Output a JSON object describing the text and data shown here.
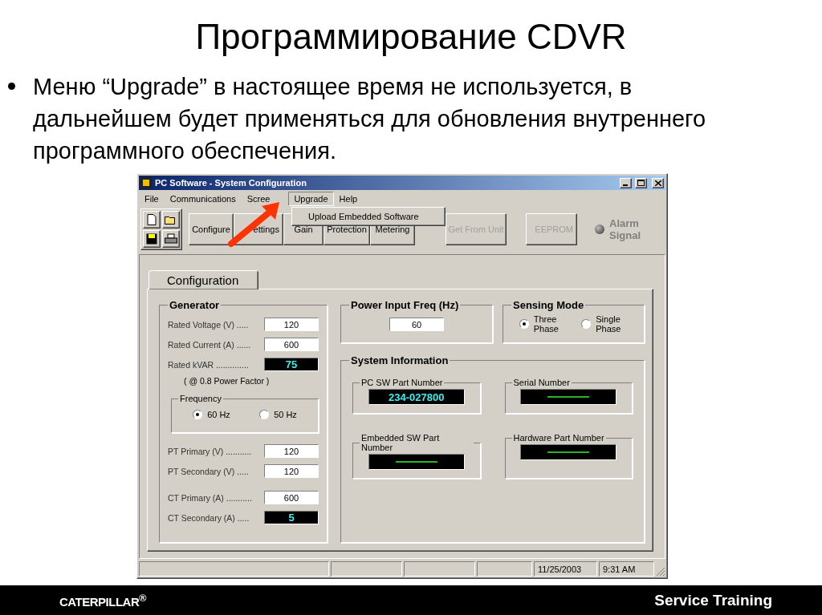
{
  "slide": {
    "title": "Программирование CDVR",
    "bullet": "Меню “Upgrade” в настоящее время не используется, в дальнейшем будет применяться для обновления внутреннего программного обеспечения."
  },
  "window": {
    "title": "PC Software - System Configuration",
    "menu": [
      {
        "label": "File",
        "selected": false
      },
      {
        "label": "Communications",
        "selected": false
      },
      {
        "label": "Scree",
        "selected": false
      },
      {
        "label": "Upgrade",
        "selected": true
      },
      {
        "label": "Help",
        "selected": false
      }
    ],
    "dropdown": [
      "Upload Embedded Software"
    ],
    "screen_buttons": [
      {
        "label": "Configure",
        "disabled": false
      },
      {
        "label": "ettings",
        "disabled": false
      },
      {
        "label": "Gain",
        "disabled": false
      },
      {
        "label": "Protection",
        "disabled": false
      },
      {
        "label": "Metering",
        "disabled": false
      }
    ],
    "unit_buttons": [
      {
        "label": "Get From Unit",
        "disabled": true
      },
      {
        "label": "EEPROM",
        "disabled": true
      }
    ],
    "alarm": {
      "label": "Alarm Signal"
    },
    "tab": {
      "label": "Configuration",
      "selected": true
    },
    "generator": {
      "title": "Generator",
      "fields_top": [
        {
          "label": "Rated Voltage (V) .....",
          "value": "120",
          "kind": "input"
        },
        {
          "label": "Rated Current (A) ......",
          "value": "600",
          "kind": "input"
        },
        {
          "label": "Rated kVAR ..............",
          "value": "75",
          "kind": "display"
        }
      ],
      "note": "( @ 0.8 Power Factor )",
      "frequency": {
        "title": "Frequency",
        "options": [
          {
            "label": "60 Hz",
            "selected": true
          },
          {
            "label": "50 Hz",
            "selected": false
          }
        ]
      },
      "fields_pt": [
        {
          "label": "PT Primary (V) ...........",
          "value": "120",
          "kind": "input"
        },
        {
          "label": "PT Secondary (V) .....",
          "value": "120",
          "kind": "input"
        }
      ],
      "fields_ct": [
        {
          "label": "CT Primary (A) ...........",
          "value": "600",
          "kind": "input"
        },
        {
          "label": "CT Secondary (A) .....",
          "value": "5",
          "kind": "display"
        }
      ]
    },
    "power_input": {
      "title": "Power Input Freq (Hz)",
      "value": "60"
    },
    "sensing_mode": {
      "title": "Sensing Mode",
      "options": [
        {
          "label": "Three Phase",
          "selected": true
        },
        {
          "label": "Single Phase",
          "selected": false
        }
      ]
    },
    "system_information": {
      "title": "System Information",
      "boxes": [
        {
          "label": "PC SW Part Number",
          "value": "234-027800"
        },
        {
          "label": "Serial Number"
        },
        {
          "label": "Embedded SW Part Number"
        },
        {
          "label": "Hardware Part Number"
        }
      ]
    },
    "status_bar": {
      "date": "11/25/2003",
      "time": "9:31 AM"
    }
  },
  "footer": {
    "brand": "CATERPILLAR$^{®}$",
    "label": "Service Training"
  }
}
